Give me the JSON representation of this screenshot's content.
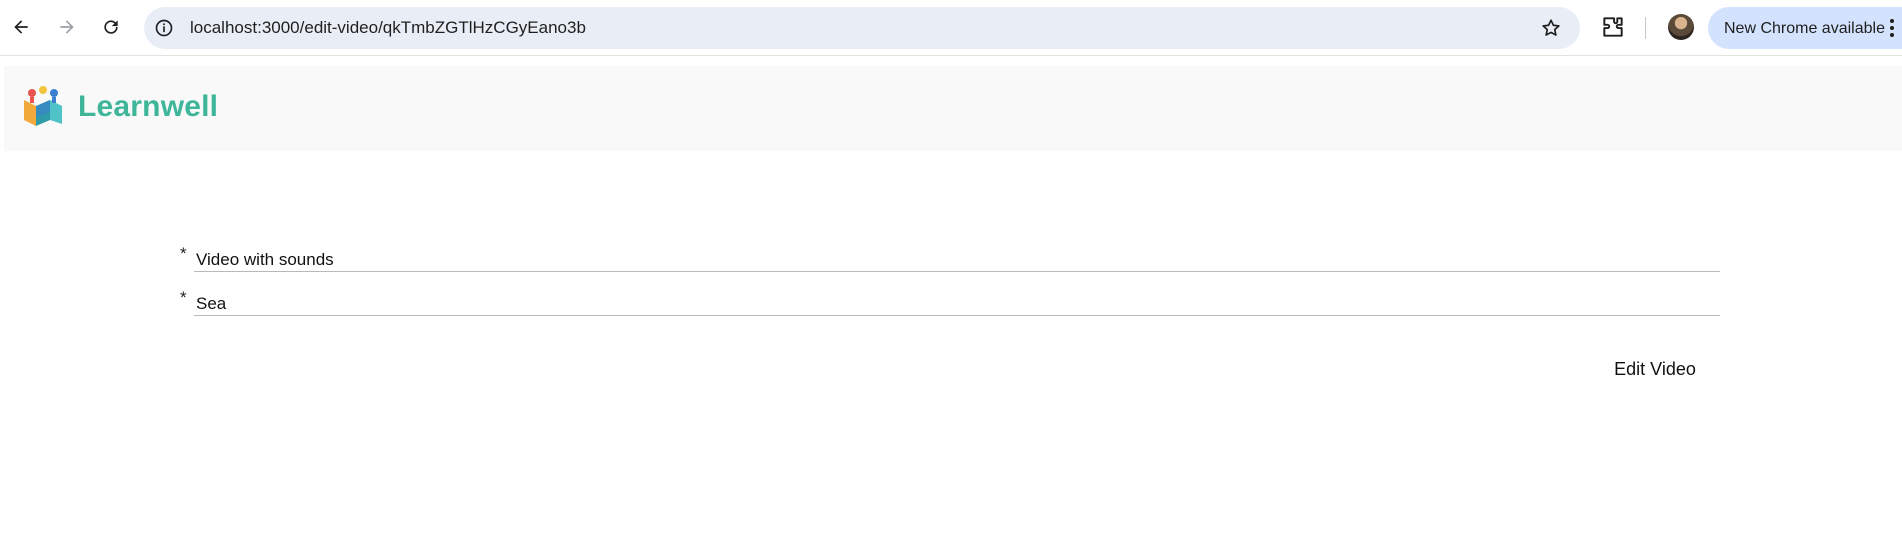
{
  "browser": {
    "url": "localhost:3000/edit-video/qkTmbZGTlHzCGyEano3b",
    "update_label": "New Chrome available",
    "icons": [
      "back-arrow-icon",
      "forward-arrow-icon",
      "reload-icon",
      "site-info-icon",
      "bookmark-star-icon",
      "extensions-puzzle-icon",
      "kebab-menu-icon"
    ]
  },
  "app": {
    "brand": "Learnwell",
    "brand_color": "#3fb69a"
  },
  "form": {
    "required_mark": "*",
    "title_value": "Video with sounds",
    "description_value": "Sea",
    "submit_label": "Edit Video"
  }
}
